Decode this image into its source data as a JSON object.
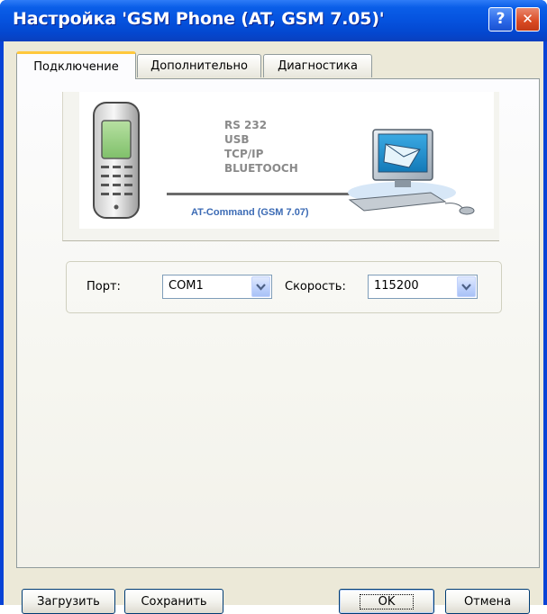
{
  "window": {
    "title": "Настройка 'GSM Phone  (AT, GSM 7.05)'"
  },
  "titlebar_buttons": {
    "help": "?",
    "close": "✕"
  },
  "tabs": [
    {
      "label": "Подключение",
      "active": true
    },
    {
      "label": "Дополнительно",
      "active": false
    },
    {
      "label": "Диагностика",
      "active": false
    }
  ],
  "connection_image": {
    "protocols": [
      "RS 232",
      "USB",
      "TCP/IP",
      "BLUETOOCH"
    ],
    "caption": "AT-Command (GSM 7.07)"
  },
  "settings": {
    "port_label": "Порт:",
    "port_value": "COM1",
    "speed_label": "Скорость:",
    "speed_value": "115200"
  },
  "buttons": {
    "load": "Загрузить",
    "save": "Сохранить",
    "ok": "OK",
    "cancel": "Отмена"
  },
  "colors": {
    "titlebar": "#0552de",
    "client": "#ece9d8",
    "active_tab_accent": "#ffc83c",
    "caption_text": "#3c6bb5"
  }
}
